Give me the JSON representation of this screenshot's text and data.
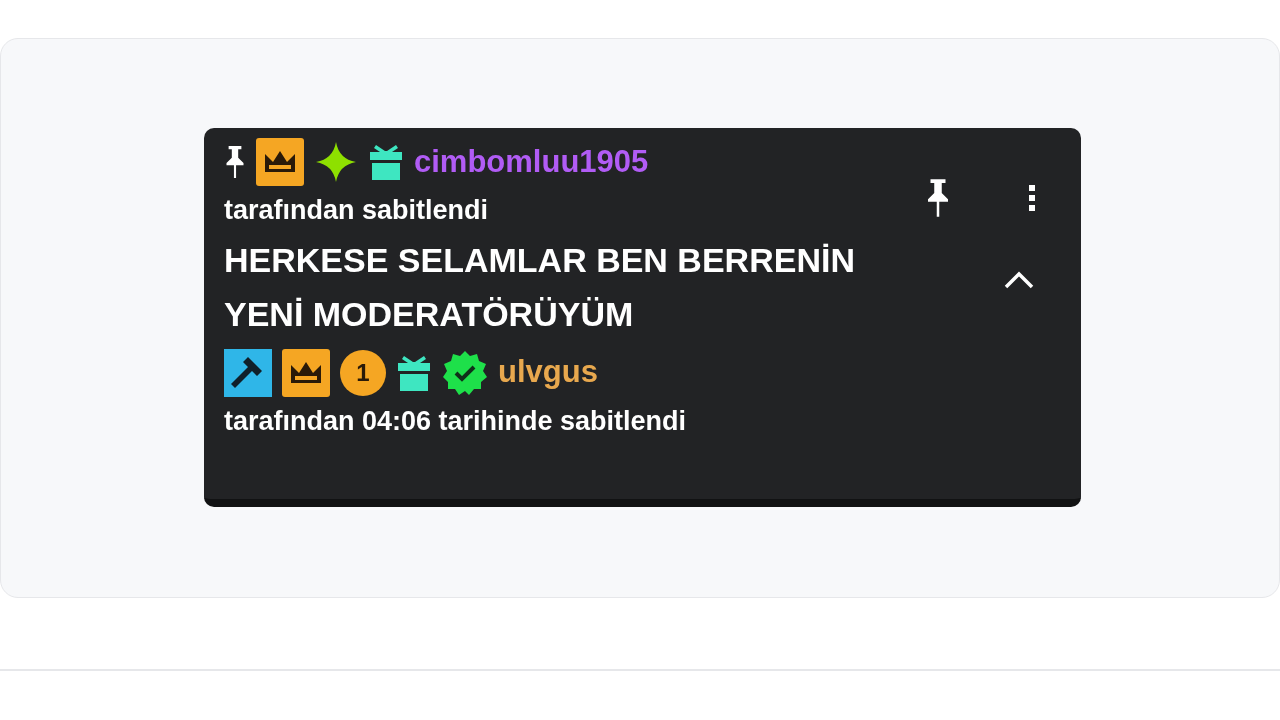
{
  "pinned_by": {
    "badges": [
      {
        "kind": "crown"
      },
      {
        "kind": "star"
      },
      {
        "kind": "gift"
      }
    ],
    "username": "cimbomluu1905",
    "color": "#b15cf5",
    "caption": "tarafından sabitlendi"
  },
  "message": "HERKESE SELAMLAR BEN BERRENİN YENİ MODERATÖRÜYÜM",
  "expanded": true,
  "updated_by": {
    "badges": [
      {
        "kind": "hammer"
      },
      {
        "kind": "crown"
      },
      {
        "kind": "coin",
        "label": "1"
      },
      {
        "kind": "gift"
      },
      {
        "kind": "verified"
      }
    ],
    "username": "ulvgus",
    "color": "#e8a84e",
    "caption": "tarafından 04:06 tarihinde sabitlendi"
  }
}
